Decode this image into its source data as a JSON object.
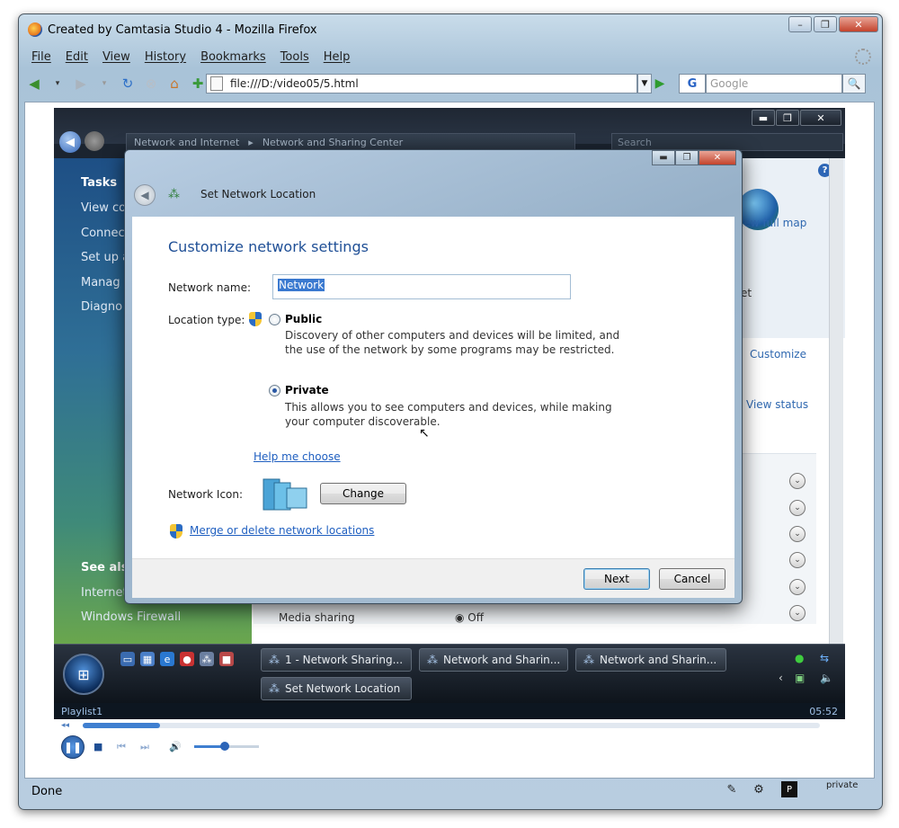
{
  "window": {
    "title": "Created by Camtasia Studio 4 - Mozilla Firefox",
    "min": "–",
    "max": "❐",
    "close": "✕"
  },
  "menu": [
    "File",
    "Edit",
    "View",
    "History",
    "Bookmarks",
    "Tools",
    "Help"
  ],
  "nav": {
    "url": "file:///D:/video05/5.html",
    "search_placeholder": "Google",
    "search_engine": "G"
  },
  "vista": {
    "breadcrumb": [
      "Network and Internet",
      "Network and Sharing Center"
    ],
    "search_placeholder": "Search",
    "left_pane": {
      "tasks_title": "Tasks",
      "tasks": [
        "View co",
        "Connec",
        "Set up a",
        "Manag",
        "Diagno"
      ],
      "see_also_title": "See als",
      "see_also": [
        "Internet",
        "Windows Firewall"
      ]
    },
    "right_pane": {
      "view_full_map": "iew full map",
      "customize": "Customize",
      "view_status": "View status",
      "et_label": "et"
    },
    "media_sharing": {
      "label": "Media sharing",
      "value": "Off"
    },
    "dialog": {
      "title": "Set Network Location",
      "heading": "Customize network settings",
      "network_name_label": "Network name:",
      "network_name_value": "Network",
      "location_type_label": "Location type:",
      "public": {
        "title": "Public",
        "desc": "Discovery of other computers and devices will be limited, and the use of the network by some programs may be restricted.",
        "selected": false
      },
      "private": {
        "title": "Private",
        "desc": "This allows you to see computers and devices, while making your computer discoverable.",
        "selected": true
      },
      "help_link": "Help me choose",
      "network_icon_label": "Network Icon:",
      "change_button": "Change",
      "merge_link": "Merge or delete network locations",
      "next_button": "Next",
      "cancel_button": "Cancel"
    },
    "taskbar": {
      "tasks": [
        "1 - Network Sharing...",
        "Network and Sharin...",
        "Network and Sharin...",
        "Set Network Location"
      ]
    }
  },
  "media_player": {
    "playlist": "Playlist1",
    "time": "05:52",
    "progress_fraction": 0.105,
    "volume_fraction": 0.47
  },
  "status": {
    "text": "Done",
    "private": "private"
  }
}
